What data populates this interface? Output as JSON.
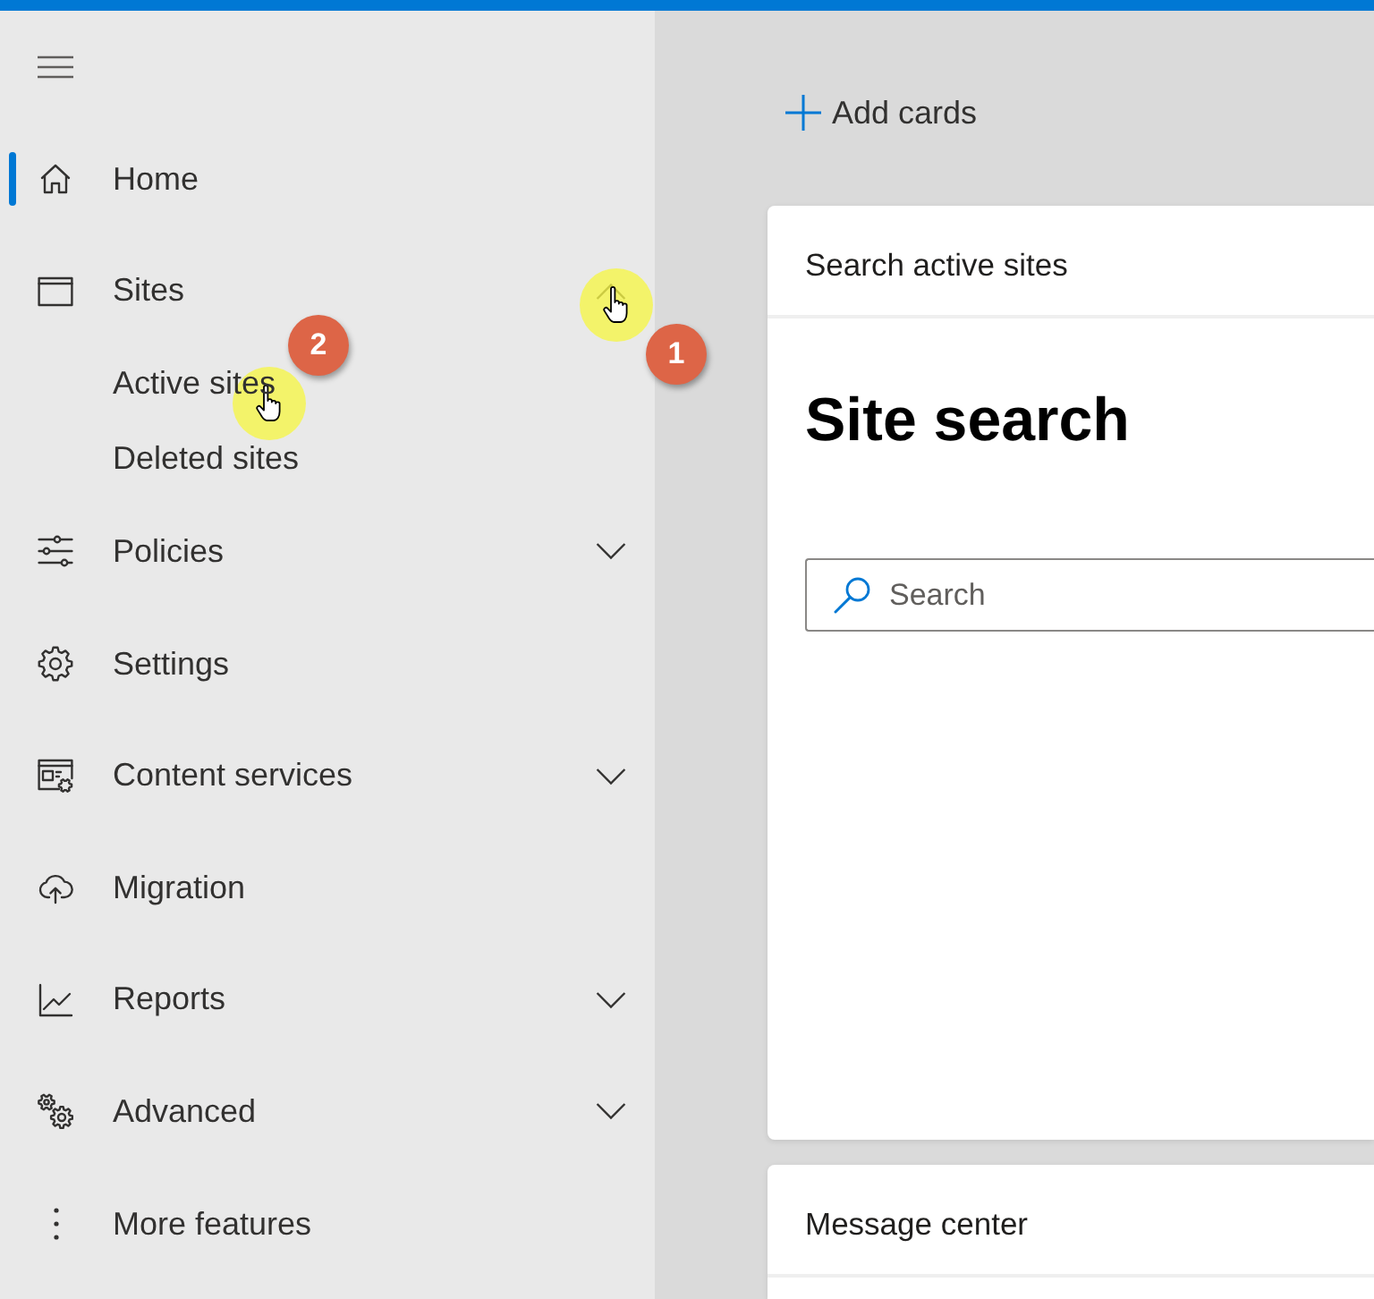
{
  "sidebar": {
    "items": [
      {
        "kind": "link",
        "label": "Home",
        "selected": true
      },
      {
        "kind": "group",
        "label": "Sites",
        "selected": false,
        "expanded": true,
        "children": [
          {
            "label": "Active sites",
            "selected": false
          },
          {
            "label": "Deleted sites",
            "selected": false
          }
        ]
      },
      {
        "kind": "group",
        "label": "Policies",
        "selected": false,
        "expanded": false
      },
      {
        "kind": "link",
        "label": "Settings",
        "selected": false
      },
      {
        "kind": "group",
        "label": "Content services",
        "selected": false,
        "expanded": false
      },
      {
        "kind": "link",
        "label": "Migration",
        "selected": false
      },
      {
        "kind": "group",
        "label": "Reports",
        "selected": false,
        "expanded": false
      },
      {
        "kind": "group",
        "label": "Advanced",
        "selected": false,
        "expanded": false
      },
      {
        "kind": "link",
        "label": "More features",
        "selected": false
      }
    ]
  },
  "toolbar": {
    "add_cards": "Add cards"
  },
  "cards": [
    {
      "title": "Search active sites",
      "heading": "Site search",
      "search": {
        "placeholder": "Search"
      }
    },
    {
      "title": "Message center"
    }
  ],
  "annotations": [
    {
      "label": "1"
    },
    {
      "label": "2"
    }
  ]
}
